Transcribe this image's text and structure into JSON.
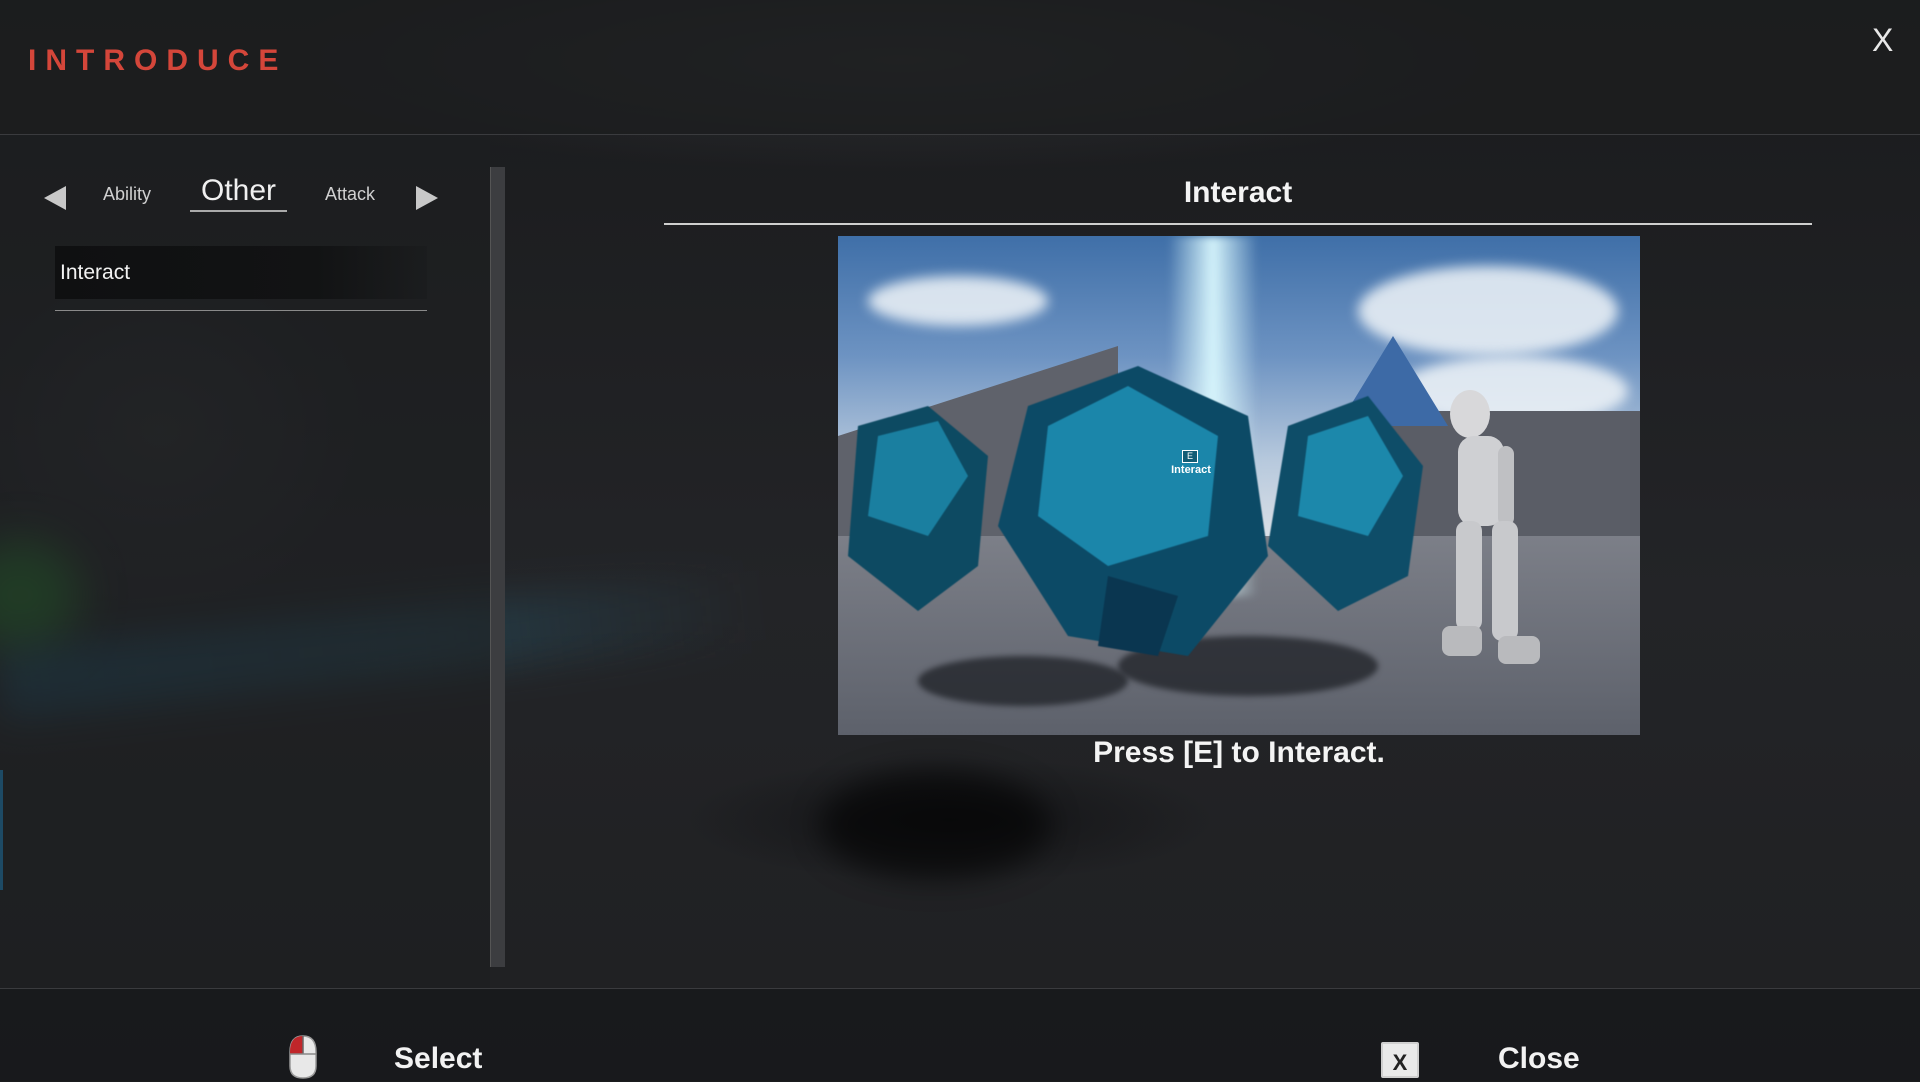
{
  "header": {
    "title": "INTRODUCE",
    "close_label": "X"
  },
  "categories": {
    "prev": "Ability",
    "current": "Other",
    "next": "Attack"
  },
  "list": {
    "items": [
      {
        "label": "Interact",
        "selected": true
      }
    ]
  },
  "detail": {
    "title": "Interact",
    "image_prompt_key": "E",
    "image_prompt_label": "Interact",
    "caption": "Press [E] to Interact."
  },
  "footer": {
    "select_label": "Select",
    "close_key": "X",
    "close_label": "Close"
  },
  "colors": {
    "title_accent": "#d4463a",
    "background": "#1b1c1e",
    "text": "#f2f2f2"
  }
}
